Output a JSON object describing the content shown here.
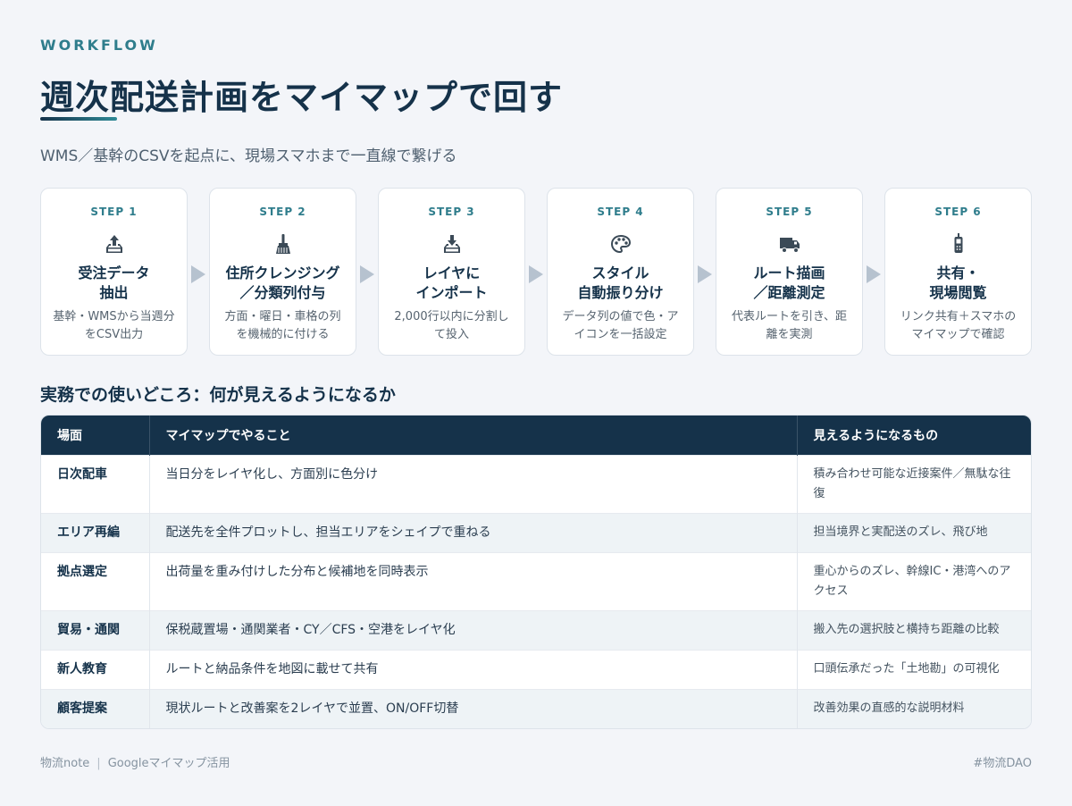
{
  "header": {
    "eyebrow": "WORKFLOW",
    "title": "週次配送計画をマイマップで回す",
    "subtitle": "WMS／基幹のCSVを起点に、現場スマホまで一直線で繋げる",
    "accent": "#2f7d8c",
    "navy": "#15324a"
  },
  "steps": [
    {
      "label": "STEP 1",
      "icon": "upload-tray-icon",
      "title_1": "受注データ",
      "title_2": "抽出",
      "desc_1": "基幹・WMSから当週分",
      "desc_2": "をCSV出力"
    },
    {
      "label": "STEP 2",
      "icon": "broom-icon",
      "title_1": "住所クレンジング",
      "title_2": "／分類列付与",
      "desc_1": "方面・曜日・車格の列",
      "desc_2": "を機械的に付ける"
    },
    {
      "label": "STEP 3",
      "icon": "inbox-download-icon",
      "title_1": "レイヤに",
      "title_2": "インポート",
      "desc_1": "2,000行以内に分割し",
      "desc_2": "て投入"
    },
    {
      "label": "STEP 4",
      "icon": "palette-icon",
      "title_1": "スタイル",
      "title_2": "自動振り分け",
      "desc_1": "データ列の値で色・ア",
      "desc_2": "イコンを一括設定"
    },
    {
      "label": "STEP 5",
      "icon": "truck-icon",
      "title_1": "ルート描画",
      "title_2": "／距離測定",
      "desc_1": "代表ルートを引き、距",
      "desc_2": "離を実測"
    },
    {
      "label": "STEP 6",
      "icon": "mobile-phone-icon",
      "title_1": "共有・",
      "title_2": "現場閲覧",
      "desc_1": "リンク共有＋スマホの",
      "desc_2": "マイマップで確認"
    }
  ],
  "section": {
    "heading": "実務での使いどころ：何が見えるようになるか"
  },
  "table": {
    "headers": [
      "場面",
      "マイマップでやること",
      "見えるようになるもの"
    ],
    "rows": [
      {
        "scene": "日次配車",
        "action": "当日分をレイヤ化し、方面別に色分け",
        "result": "積み合わせ可能な近接案件／無駄な往復"
      },
      {
        "scene": "エリア再編",
        "action": "配送先を全件プロットし、担当エリアをシェイプで重ねる",
        "result": "担当境界と実配送のズレ、飛び地"
      },
      {
        "scene": "拠点選定",
        "action": "出荷量を重み付けした分布と候補地を同時表示",
        "result": "重心からのズレ、幹線IC・港湾へのアクセス"
      },
      {
        "scene": "貿易・通関",
        "action": "保税蔵置場・通関業者・CY／CFS・空港をレイヤ化",
        "result": "搬入先の選択肢と横持ち距離の比較"
      },
      {
        "scene": "新人教育",
        "action": "ルートと納品条件を地図に載せて共有",
        "result": "口頭伝承だった「土地勘」の可視化"
      },
      {
        "scene": "顧客提案",
        "action": "現状ルートと改善案を2レイヤで並置、ON/OFF切替",
        "result": "改善効果の直感的な説明材料"
      }
    ]
  },
  "footer": {
    "source": "物流note",
    "separator": "|",
    "topic": "Googleマイマップ活用",
    "hashtag": "#物流DAO"
  }
}
